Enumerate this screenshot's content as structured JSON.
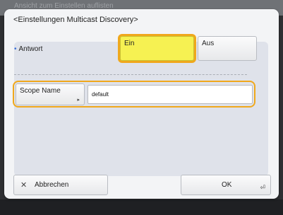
{
  "background": {
    "title": "Ansicht zum Einstellen auflisten"
  },
  "dialog": {
    "title": "<Einstellungen Multicast Discovery>",
    "antwort": {
      "bullet": "•",
      "label": "Antwort",
      "option_on": "Ein",
      "option_off": "Aus",
      "selected": "Ein"
    },
    "scope": {
      "button_label": "Scope Name",
      "button_arrow": "▸",
      "value": "default"
    }
  },
  "footer": {
    "cancel_icon": "✕",
    "cancel_label": "Abbrechen",
    "ok_label": "OK",
    "ok_icon": "⏎"
  },
  "colors": {
    "highlight": "#f0a81c",
    "selected_fill": "#f6f152",
    "panel": "#dfe2ea",
    "accent_bullet": "#3b6fd6"
  }
}
